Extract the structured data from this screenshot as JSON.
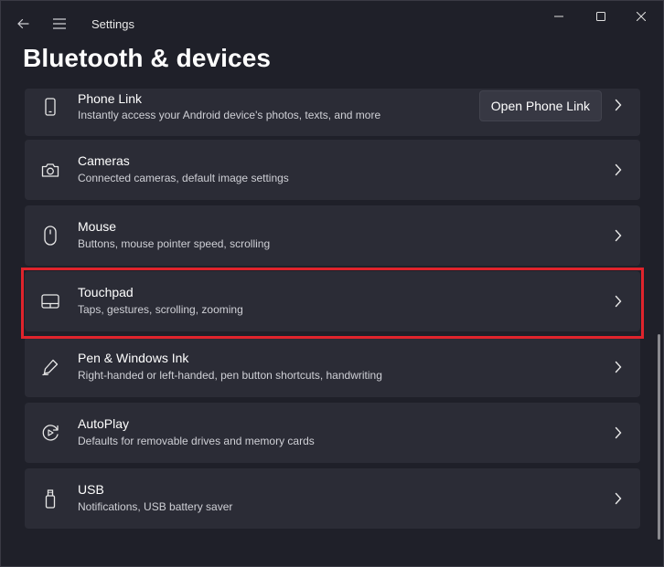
{
  "window": {
    "app_title": "Settings"
  },
  "page": {
    "title": "Bluetooth & devices"
  },
  "items": [
    {
      "title": "Phone Link",
      "description": "Instantly access your Android device's photos, texts, and more",
      "icon": "phone-icon",
      "button": "Open Phone Link"
    },
    {
      "title": "Cameras",
      "description": "Connected cameras, default image settings",
      "icon": "camera-icon"
    },
    {
      "title": "Mouse",
      "description": "Buttons, mouse pointer speed, scrolling",
      "icon": "mouse-icon"
    },
    {
      "title": "Touchpad",
      "description": "Taps, gestures, scrolling, zooming",
      "icon": "touchpad-icon",
      "highlighted": true
    },
    {
      "title": "Pen & Windows Ink",
      "description": "Right-handed or left-handed, pen button shortcuts, handwriting",
      "icon": "pen-icon"
    },
    {
      "title": "AutoPlay",
      "description": "Defaults for removable drives and memory cards",
      "icon": "autoplay-icon"
    },
    {
      "title": "USB",
      "description": "Notifications, USB battery saver",
      "icon": "usb-icon"
    }
  ],
  "colors": {
    "background": "#1f2029",
    "card": "#2b2c36",
    "highlight": "#e0242c"
  }
}
